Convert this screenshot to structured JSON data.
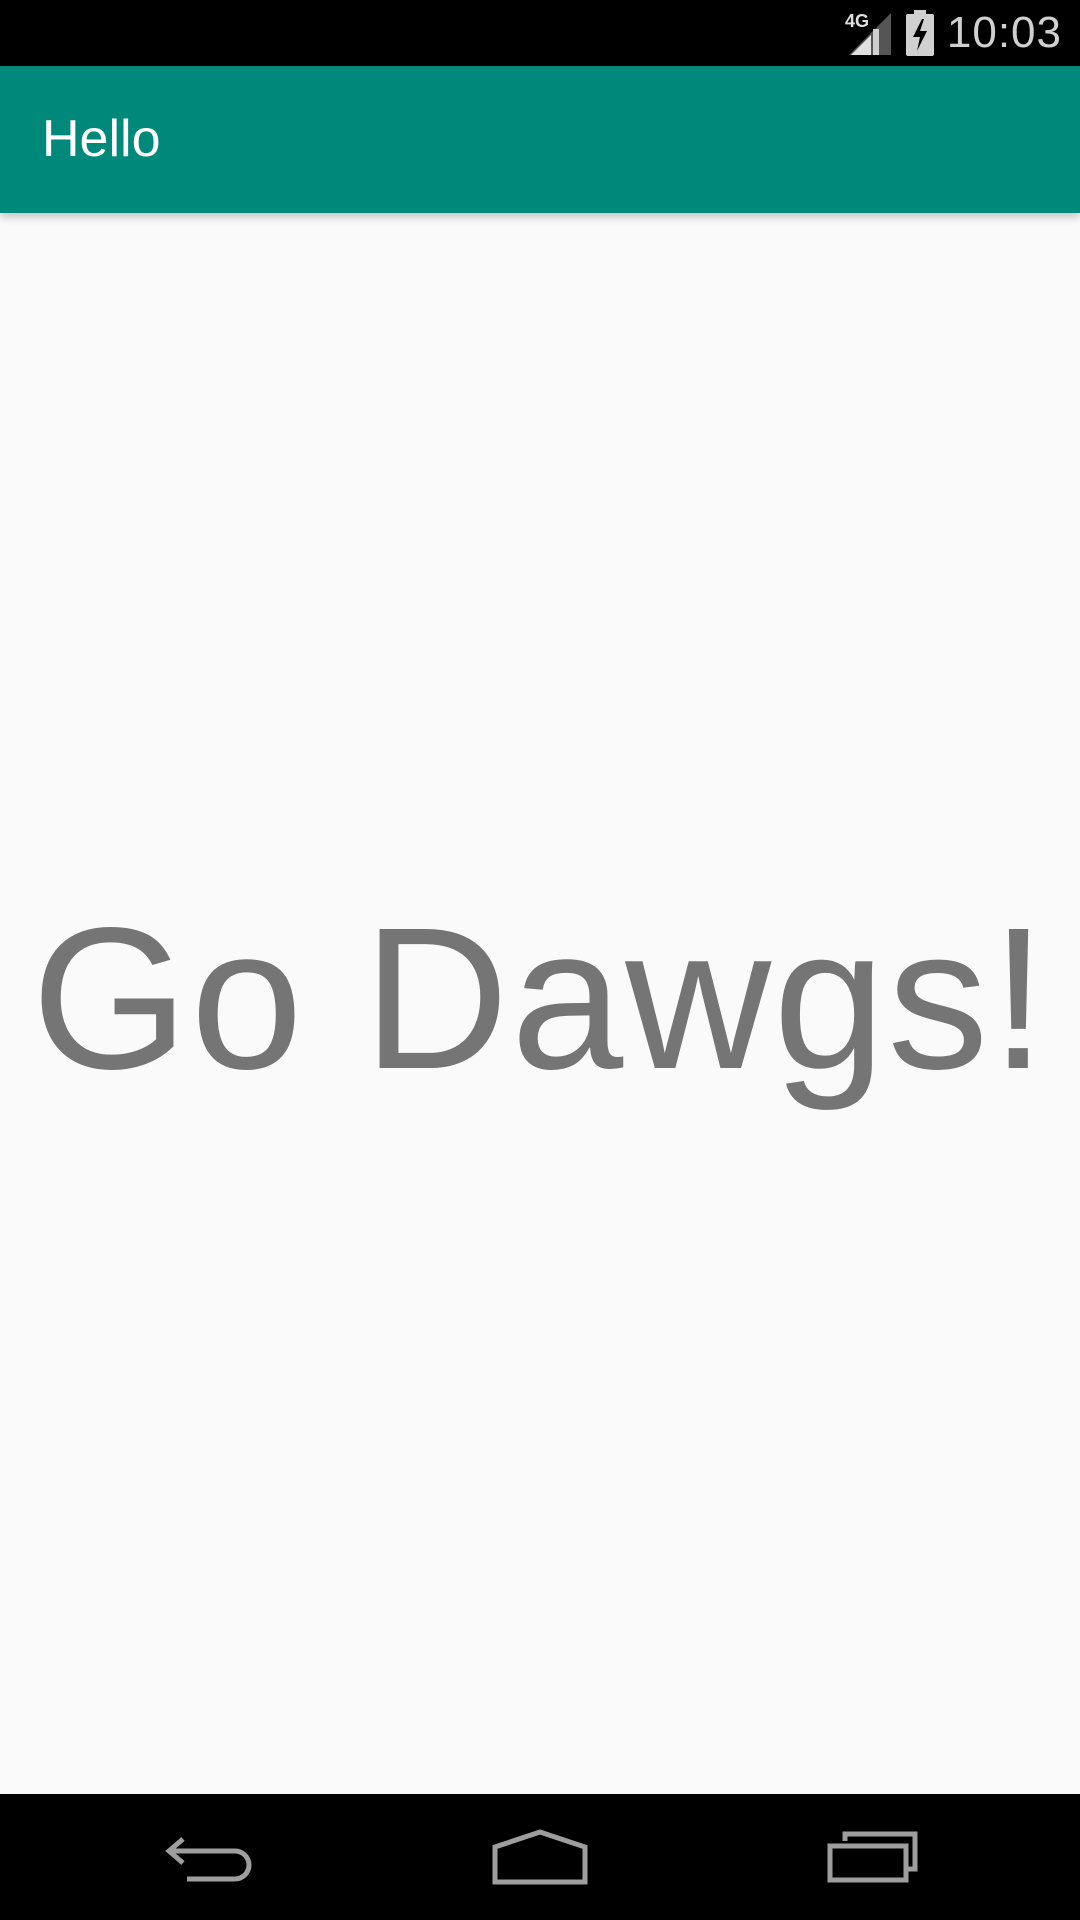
{
  "status_bar": {
    "network_label": "4G",
    "time": "10:03",
    "icons": [
      "signal-4g-icon",
      "battery-charging-icon"
    ]
  },
  "app_bar": {
    "title": "Hello",
    "color": "#00897b"
  },
  "content": {
    "headline": "Go Dawgs!",
    "text_color": "#757575"
  },
  "nav_bar": {
    "buttons": [
      "back-icon",
      "home-icon",
      "recents-icon"
    ]
  }
}
